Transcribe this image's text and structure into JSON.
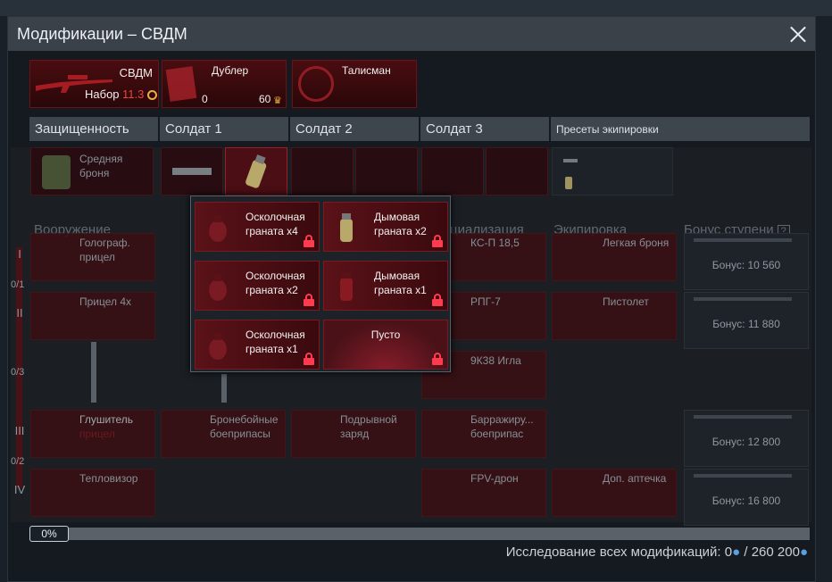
{
  "window": {
    "title": "Модификации – СВДМ"
  },
  "top_cards": {
    "weapon": {
      "name": "СВДМ",
      "set_label": "Набор",
      "set_value": "11.3"
    },
    "duplicate": {
      "name": "Дублер",
      "count": "0",
      "price": "60"
    },
    "talisman": {
      "name": "Талисман"
    }
  },
  "headers": [
    "Защищенность",
    "Солдат 1",
    "Солдат 2",
    "Солдат 3",
    "Пресеты экипировки"
  ],
  "protection": {
    "armor": "Средняя броня"
  },
  "sections": {
    "weapons": "Вооружение",
    "specialization": "циализация",
    "equipment": "Экипировка",
    "bonus": "Бонус ступени"
  },
  "tiers": [
    {
      "roman": "I",
      "count": "0/1"
    },
    {
      "roman": "II",
      "count": "0/3"
    },
    {
      "roman": "III",
      "count": "0/2"
    },
    {
      "roman": "IV",
      "count": ""
    }
  ],
  "weapons": {
    "row1": "Голограф. прицел",
    "row2": "Прицел 4х",
    "row3_line1": "Глушитель",
    "row3_line2": "прицел",
    "row4": "Тепловизор",
    "ap_ammo": "Бронебойные боеприпасы",
    "demo_charge": "Подрывной заряд"
  },
  "specialization": {
    "r1": "КС-П 18,5",
    "r2": "РПГ-7",
    "r2b": "9К38 Игла",
    "r3": "Барражиру... боеприпас",
    "r4": "FPV-дрон"
  },
  "equipment": {
    "r1": "Легкая броня",
    "r2": "Пистолет",
    "r4": "Доп. аптечка"
  },
  "bonuses": [
    "Бонус: 10 560",
    "Бонус: 11 880",
    "Бонус: 12 800",
    "Бонус: 16 800"
  ],
  "popup": {
    "items": [
      {
        "label": "Осколочная граната х4",
        "kind": "frag"
      },
      {
        "label": "Дымовая граната х2",
        "kind": "smoke"
      },
      {
        "label": "Осколочная граната х2",
        "kind": "frag"
      },
      {
        "label": "Дымовая граната х1",
        "kind": "smoke-red"
      },
      {
        "label": "Осколочная граната х1",
        "kind": "frag"
      },
      {
        "label": "Пусто",
        "kind": "empty"
      }
    ]
  },
  "footer": {
    "progress_pct": "0%",
    "progress_value": 0,
    "research_label": "Исследование всех модификаций:",
    "research_value": "0",
    "research_sep": "/",
    "research_total": "260 200"
  },
  "colors": {
    "accent": "#d8403d",
    "lock": "#ff3b4d",
    "card": "#4a0d10"
  }
}
